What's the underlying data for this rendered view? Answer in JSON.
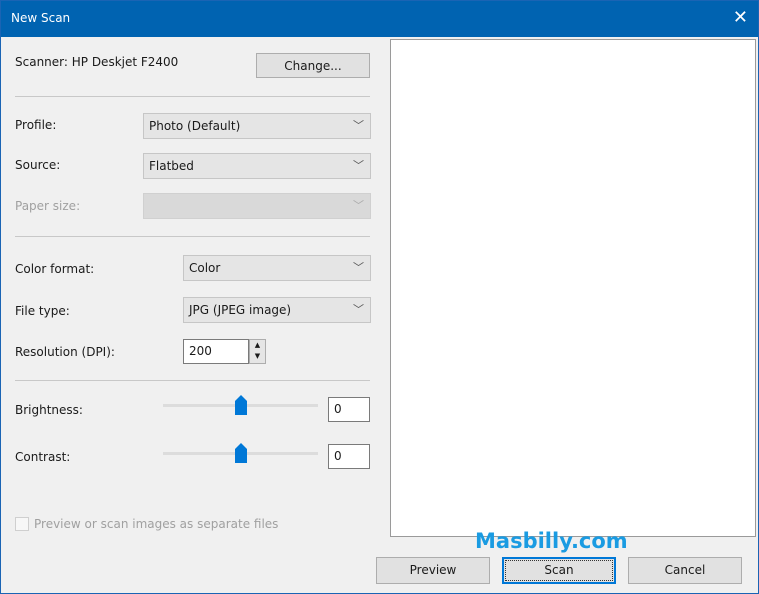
{
  "window": {
    "title": "New Scan",
    "close_icon": "close-icon"
  },
  "scanner": {
    "label": "Scanner: HP Deskjet F2400",
    "change_label": "Change..."
  },
  "profile": {
    "label": "Profile:",
    "value": "Photo (Default)"
  },
  "source": {
    "label": "Source:",
    "value": "Flatbed"
  },
  "paper_size": {
    "label": "Paper size:",
    "value": ""
  },
  "color_format": {
    "label": "Color format:",
    "value": "Color"
  },
  "file_type": {
    "label": "File type:",
    "value": "JPG (JPEG image)"
  },
  "resolution": {
    "label": "Resolution (DPI):",
    "value": "200"
  },
  "brightness": {
    "label": "Brightness:",
    "value": "0",
    "slider_percent": 50
  },
  "contrast": {
    "label": "Contrast:",
    "value": "0",
    "slider_percent": 50
  },
  "separate_files": {
    "label": "Preview or scan images as separate files",
    "checked": false
  },
  "watermark": "Masbilly.com",
  "buttons": {
    "preview": "Preview",
    "scan": "Scan",
    "cancel": "Cancel"
  },
  "colors": {
    "titlebar": "#0063b1",
    "accent": "#0078d7",
    "watermark": "#1a9be2"
  }
}
